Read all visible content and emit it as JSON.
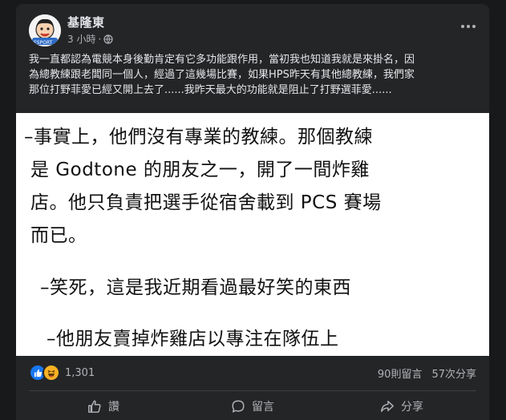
{
  "post": {
    "author": "基隆東",
    "time": "3 小時",
    "separator": "·",
    "text_lines": [
      "我一直都認為電競本身後勤肯定有它多功能跟作用，當初我也知道我就是來掛名，因",
      "為總教練跟老闆同一個人，經過了這幾場比賽，如果HPS昨天有其他總教練，我們家",
      "那位打野菲愛已經又開上去了......我昨天最大的功能就是阻止了打野選菲愛......"
    ],
    "image_lines": [
      "–事實上，他們沒有專業的教練。那個教練",
      "是 Godtone 的朋友之一，開了一間炸雞",
      "店。他只負責把選手從宿舍載到 PCS 賽場",
      "而已。",
      "–笑死，這是我近期看過最好笑的東西",
      "–他朋友賣掉炸雞店以專注在隊伍上"
    ]
  },
  "stats": {
    "reaction_count": "1,301",
    "comments": "90則留言",
    "shares": "57次分享"
  },
  "actions": {
    "like": "讚",
    "comment": "留言",
    "share": "分享"
  },
  "icons": {
    "privacy": "globe-icon",
    "more": "more-options-icon",
    "reaction_1": "like-reaction-icon",
    "reaction_2": "haha-reaction-icon"
  },
  "colors": {
    "background": "#18191a",
    "card": "#242526",
    "like_blue": "#1877f2",
    "haha_yellow": "#f7b125"
  }
}
